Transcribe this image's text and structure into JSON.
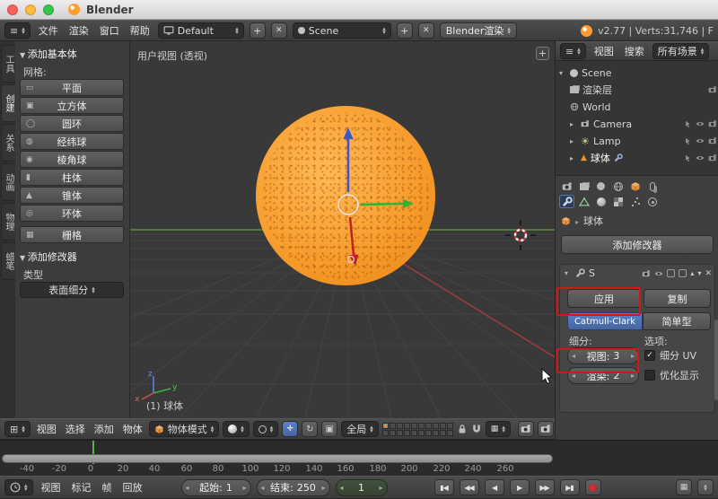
{
  "titlebar": {
    "title": "Blender"
  },
  "menubar": {
    "menus": [
      "文件",
      "渲染",
      "窗口",
      "帮助"
    ],
    "layout_value": "Default",
    "scene_value": "Scene",
    "engine_value": "Blender渲染",
    "stats": "v2.77 | Verts:31,746 | F"
  },
  "toolshelf": {
    "tabs": [
      "工具",
      "创建",
      "关系",
      "动画",
      "物理",
      "蜡笔"
    ],
    "panels": {
      "add_primitive": "添加基本体",
      "add_modifier": "添加修改器"
    },
    "mesh_label": "网格:",
    "mesh_buttons": [
      {
        "icon": "▭",
        "label": "平面"
      },
      {
        "icon": "▣",
        "label": "立方体"
      },
      {
        "icon": "◯",
        "label": "圆环"
      },
      {
        "icon": "◍",
        "label": "经纬球"
      },
      {
        "icon": "◉",
        "label": "棱角球"
      },
      {
        "icon": "▮",
        "label": "柱体"
      },
      {
        "icon": "▲",
        "label": "锥体"
      },
      {
        "icon": "◎",
        "label": "环体"
      },
      {
        "icon": "▦",
        "label": "栅格"
      }
    ],
    "type_label": "类型",
    "modifier_type_value": "表面细分"
  },
  "viewport": {
    "view_label": "用户视图 (透视)",
    "object_label": "(1) 球体",
    "gizmo": {
      "x": "x",
      "y": "y",
      "z": "z"
    },
    "header": {
      "menus": [
        "视图",
        "选择",
        "添加",
        "物体"
      ],
      "mode_value": "物体模式",
      "orientation_value": "全局"
    }
  },
  "outliner": {
    "menus": [
      "视图",
      "搜索"
    ],
    "display_filter": "所有场景",
    "items": [
      {
        "label": "Scene"
      },
      {
        "label": "渲染层"
      },
      {
        "label": "World"
      },
      {
        "label": "Camera"
      },
      {
        "label": "Lamp"
      },
      {
        "label": "球体"
      }
    ]
  },
  "properties": {
    "breadcrumb_object": "球体",
    "add_modifier_label": "添加修改器",
    "modifier": {
      "name": "S",
      "apply_label": "应用",
      "copy_label": "复制",
      "catmull_label": "Catmull-Clark",
      "simple_label": "简单型",
      "subdivisions_label": "细分:",
      "options_label": "选项:",
      "view_label": "视图:",
      "view_value": "3",
      "render_label": "渲染:",
      "render_value": "2",
      "subdivide_uv_label": "细分 UV",
      "optimal_display_label": "优化显示"
    }
  },
  "timeline": {
    "ruler_labels": [
      "-40",
      "-20",
      "0",
      "20",
      "40",
      "60",
      "80",
      "100",
      "120",
      "140",
      "160",
      "180",
      "200",
      "220",
      "240",
      "260"
    ],
    "menus": [
      "视图",
      "标记",
      "帧",
      "回放"
    ],
    "start_label": "起始:",
    "start_value": "1",
    "end_label": "结束:",
    "end_value": "250",
    "current_frame": "1"
  }
}
